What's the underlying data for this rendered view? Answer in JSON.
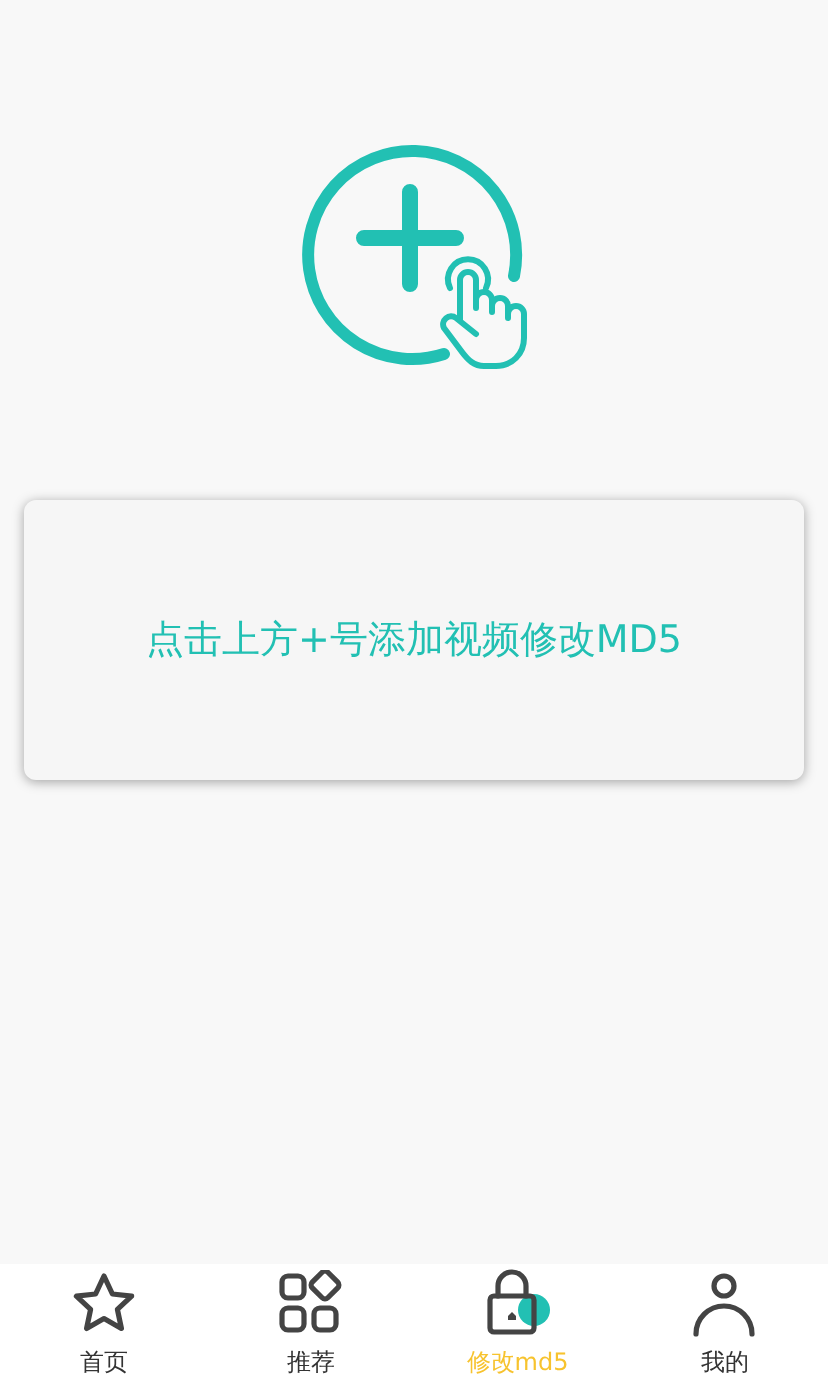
{
  "prompt": {
    "text": "点击上方+号添加视频修改MD5"
  },
  "tabs": [
    {
      "kind": "star",
      "label": "首页",
      "selected": false
    },
    {
      "kind": "grid",
      "label": "推荐",
      "selected": false
    },
    {
      "kind": "lock",
      "label": "修改md5",
      "selected": true
    },
    {
      "kind": "person",
      "label": "我的",
      "selected": false
    }
  ]
}
